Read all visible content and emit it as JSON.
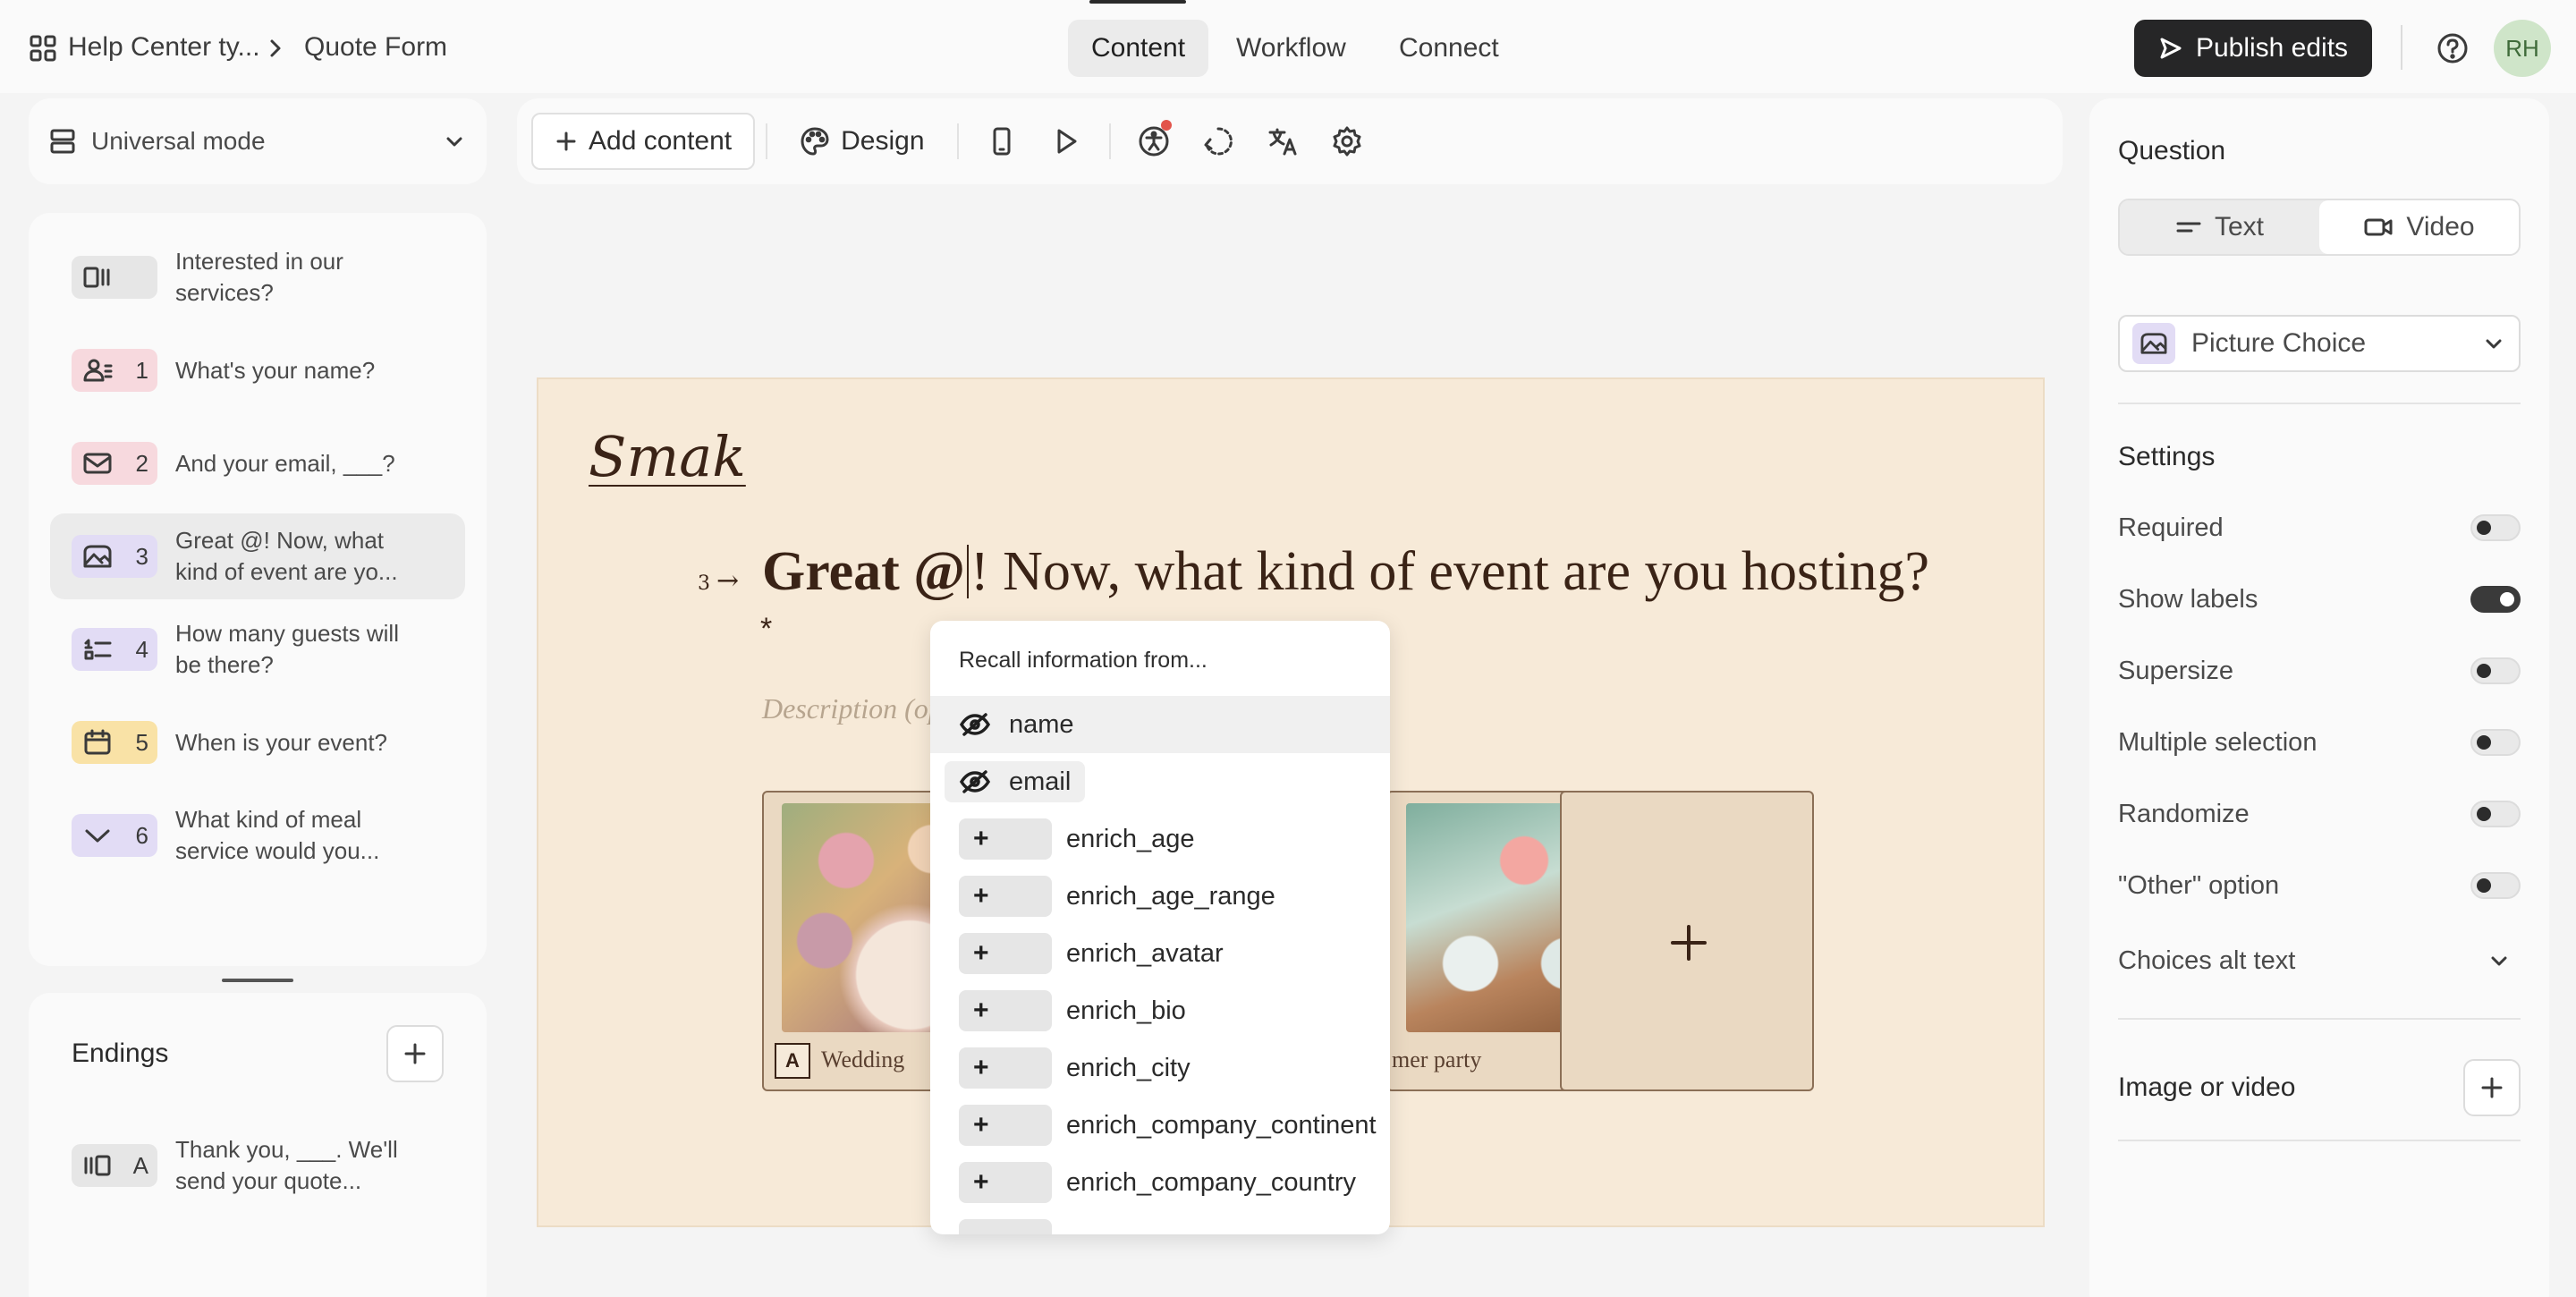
{
  "topbar": {
    "breadcrumb_workspace": "Help Center ty...",
    "breadcrumb_form": "Quote Form",
    "tabs": [
      {
        "label": "Content",
        "active": true
      },
      {
        "label": "Workflow",
        "active": false
      },
      {
        "label": "Connect",
        "active": false
      }
    ],
    "publish_label": "Publish edits",
    "avatar_initials": "RH"
  },
  "mode_selector": {
    "label": "Universal mode"
  },
  "toolbar": {
    "add_content_label": "Add content",
    "design_label": "Design",
    "icons": [
      "mobile-preview-icon",
      "play-icon",
      "accessibility-icon",
      "logic-icon",
      "translate-icon",
      "settings-icon"
    ]
  },
  "questions": [
    {
      "number": "",
      "text_line1": "Interested in our",
      "text_line2": "services?",
      "icon": "welcome-screen-icon",
      "color": "#e6e6e6"
    },
    {
      "number": "1",
      "text_line1": "What's your name?",
      "text_line2": "",
      "icon": "contact-icon",
      "color": "#f7d9de"
    },
    {
      "number": "2",
      "text_line1": "And your email, ___?",
      "text_line2": "",
      "icon": "mail-icon",
      "color": "#f7d9de"
    },
    {
      "number": "3",
      "text_line1": "Great @! Now, what",
      "text_line2": "kind of event are yo...",
      "icon": "picture-choice-icon",
      "color": "#e2dcf5"
    },
    {
      "number": "4",
      "text_line1": "How many guests will",
      "text_line2": "be there?",
      "icon": "ranking-icon",
      "color": "#e2dcf5"
    },
    {
      "number": "5",
      "text_line1": "When is your event?",
      "text_line2": "",
      "icon": "calendar-icon",
      "color": "#f9e2a6"
    },
    {
      "number": "6",
      "text_line1": "What kind of meal",
      "text_line2": "service would you...",
      "icon": "dropdown-icon",
      "color": "#e2dcf5"
    }
  ],
  "endings": {
    "title": "Endings",
    "items": [
      {
        "key": "A",
        "text_line1": "Thank you, ___. We'll",
        "text_line2": "send your quote..."
      }
    ]
  },
  "canvas": {
    "brand": "Smak",
    "question_number": "3",
    "title_bold": "Great @",
    "title_rest": "! Now, what kind of event are you hosting?",
    "required_mark": "*",
    "description_placeholder": "Description (op",
    "choices": [
      {
        "key": "A",
        "label": "Wedding"
      },
      {
        "key": "",
        "label": "mer party"
      }
    ]
  },
  "recall_menu": {
    "title": "Recall information from...",
    "hidden_fields": [
      "name",
      "email"
    ],
    "enrich_fields": [
      "enrich_age",
      "enrich_age_range",
      "enrich_avatar",
      "enrich_bio",
      "enrich_city",
      "enrich_company_continent",
      "enrich_company_country"
    ]
  },
  "right_panel": {
    "question_label": "Question",
    "segment_text": "Text",
    "segment_video": "Video",
    "question_type": "Picture Choice",
    "settings_label": "Settings",
    "settings": [
      {
        "label": "Required",
        "on": false
      },
      {
        "label": "Show labels",
        "on": true
      },
      {
        "label": "Supersize",
        "on": false
      },
      {
        "label": "Multiple selection",
        "on": false
      },
      {
        "label": "Randomize",
        "on": false
      },
      {
        "label": "\"Other\" option",
        "on": false
      }
    ],
    "alt_text_label": "Choices alt text",
    "image_video_label": "Image or video"
  }
}
